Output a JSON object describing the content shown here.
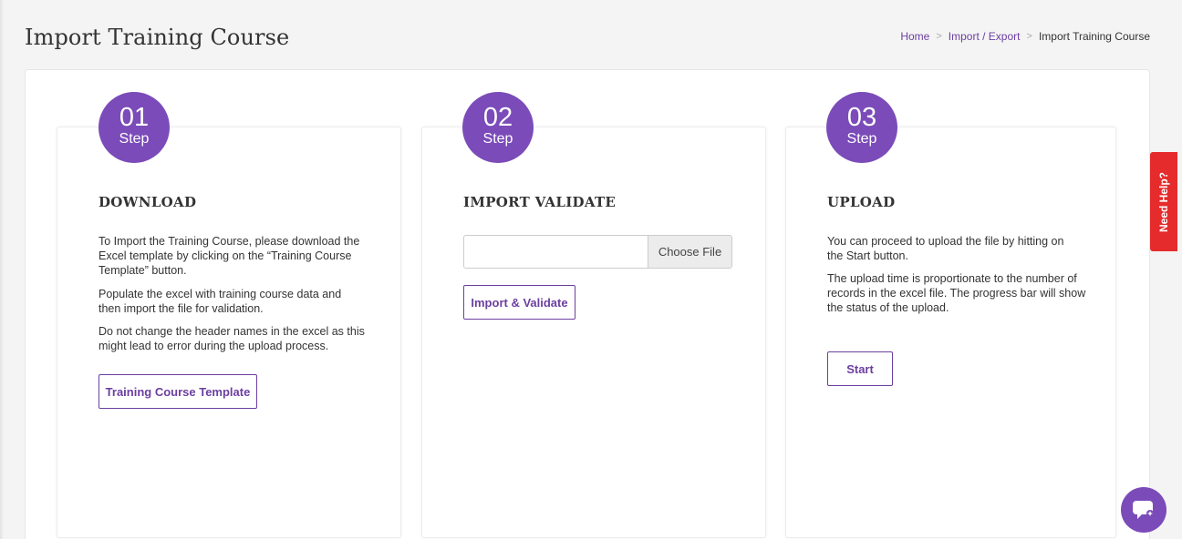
{
  "page": {
    "title": "Import Training Course"
  },
  "breadcrumb": {
    "home": "Home",
    "import_export": "Import / Export",
    "current": "Import Training Course",
    "separator": ">"
  },
  "steps": [
    {
      "number": "01",
      "word": "Step",
      "heading": "DOWNLOAD",
      "paragraphs": [
        "To Import the Training Course, please download the Excel template by clicking on the “Training Course Template” button.",
        "Populate the excel with training course data and then import the file for validation.",
        "Do not change the header names in the excel as this might lead to error during the upload process."
      ],
      "button_label": "Training Course Template"
    },
    {
      "number": "02",
      "word": "Step",
      "heading": "IMPORT VALIDATE",
      "file_input": {
        "value": "",
        "choose_label": "Choose File"
      },
      "button_label": "Import & Validate"
    },
    {
      "number": "03",
      "word": "Step",
      "heading": "UPLOAD",
      "paragraphs": [
        "You can proceed to upload the file by hitting on the Start button.",
        "The upload time is proportionate to the number of records in the excel file. The progress bar will show the status of the upload."
      ],
      "button_label": "Start"
    }
  ],
  "need_help": {
    "label": "Need Help?"
  },
  "chat": {
    "icon": "chat-bubble-icon"
  },
  "colors": {
    "accent": "#7b4bb9",
    "link": "#6c3fa0",
    "help_tab": "#e52b2b",
    "background": "#f4f4f4"
  }
}
